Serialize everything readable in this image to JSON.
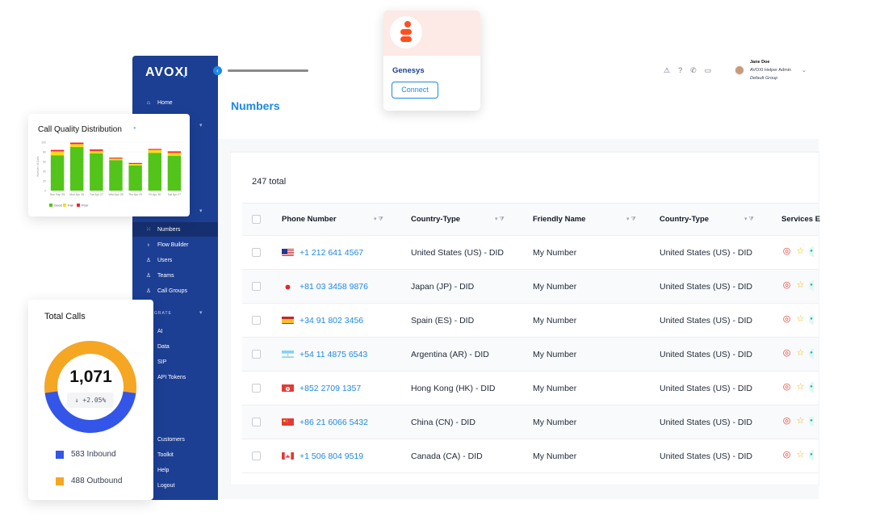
{
  "brand": {
    "logo": "AVOXI",
    "accent": "#1e88e5",
    "sidebar_bg": "#1c3f94"
  },
  "page": {
    "title": "Numbers",
    "total": "247 total"
  },
  "user": {
    "name": "Jane Doe",
    "role": "AVOXI Helper Admin",
    "group": "Default Group"
  },
  "topbar_icons": [
    "alert-icon",
    "help-icon",
    "phone-icon",
    "message-icon"
  ],
  "sidebar": {
    "items_top": [
      {
        "label": "Home",
        "icon": "home-icon"
      }
    ],
    "items_main": [
      {
        "label": "Numbers",
        "icon": "grid-icon",
        "active": true
      },
      {
        "label": "Flow Builder",
        "icon": "flow-icon"
      },
      {
        "label": "Users",
        "icon": "user-icon"
      },
      {
        "label": "Teams",
        "icon": "teams-icon"
      },
      {
        "label": "Call Groups",
        "icon": "group-icon"
      }
    ],
    "section_integrate": "GRATE",
    "items_integrate": [
      "AI",
      "Data",
      "SIP",
      "API Tokens"
    ],
    "items_bottom": [
      "Customers",
      "Toolkit",
      "Help",
      "Logout"
    ]
  },
  "table": {
    "columns": [
      "Phone Number",
      "Country-Type",
      "Friendly Name",
      "Country-Type",
      "Services E"
    ],
    "rows": [
      {
        "phone": "+1 212 641 4567",
        "country": "United States (US) - DID",
        "friendly": "My Number",
        "country2": "United States (US) - DID",
        "flag": "us"
      },
      {
        "phone": "+81 03 3458 9876",
        "country": "Japan (JP) - DID",
        "friendly": "My Number",
        "country2": "United States (US) - DID",
        "flag": "jp"
      },
      {
        "phone": "+34 91 802 3456",
        "country": "Spain (ES) - DID",
        "friendly": "My Number",
        "country2": "United States (US) - DID",
        "flag": "es"
      },
      {
        "phone": "+54 11 4875 6543",
        "country": "Argentina (AR) - DID",
        "friendly": "My Number",
        "country2": "United States (US) - DID",
        "flag": "ar"
      },
      {
        "phone": "+852 2709 1357",
        "country": "Hong Kong (HK) - DID",
        "friendly": "My Number",
        "country2": "United States (US) - DID",
        "flag": "hk"
      },
      {
        "phone": "+86 21 6066 5432",
        "country": "China (CN) - DID",
        "friendly": "My Number",
        "country2": "United States (US) - DID",
        "flag": "cn"
      },
      {
        "phone": "+1 506 804 9519",
        "country": "Canada (CA) - DID",
        "friendly": "My Number",
        "country2": "United States (US) - DID",
        "flag": "ca"
      }
    ]
  },
  "genesys": {
    "name": "Genesys",
    "button": "Connect",
    "brand_color": "#ff4f1f"
  },
  "call_quality": {
    "title": "Call Quality Distribution",
    "colors": {
      "good": "#52c41a",
      "fair": "#fadb14",
      "poor": "#f5222d"
    },
    "chart_data": {
      "type": "bar",
      "stacked": true,
      "ylabel": "Number of Calls",
      "categories": [
        "Sun Sep 25",
        "Mon Apr 26",
        "Tue Apr 27",
        "Wed Apr 28",
        "Thu Apr 29",
        "Fri Apr 30",
        "Sat Apr 27"
      ],
      "ylim": [
        0,
        100
      ],
      "yticks": [
        0,
        20,
        40,
        60,
        80,
        100
      ],
      "series": [
        {
          "name": "Good",
          "values": [
            73,
            90,
            77,
            63,
            52,
            78,
            72
          ]
        },
        {
          "name": "Fair",
          "values": [
            8,
            6,
            5,
            3,
            3,
            6,
            6
          ]
        },
        {
          "name": "Poor",
          "values": [
            3,
            3,
            3,
            2,
            2,
            2,
            3
          ]
        }
      ],
      "legend": "bottom-left"
    }
  },
  "total_calls": {
    "title": "Total Calls",
    "total": "1,071",
    "delta": "+2.05%",
    "chart_data": {
      "type": "pie",
      "donut": true,
      "labels": [
        "Inbound",
        "Outbound"
      ],
      "values": [
        583,
        488
      ],
      "colors": [
        "#f5a623",
        "#3355e8"
      ]
    },
    "legend": [
      {
        "label": "583 Inbound",
        "color": "#3355e8"
      },
      {
        "label": "488 Outbound",
        "color": "#f5a623"
      }
    ]
  }
}
